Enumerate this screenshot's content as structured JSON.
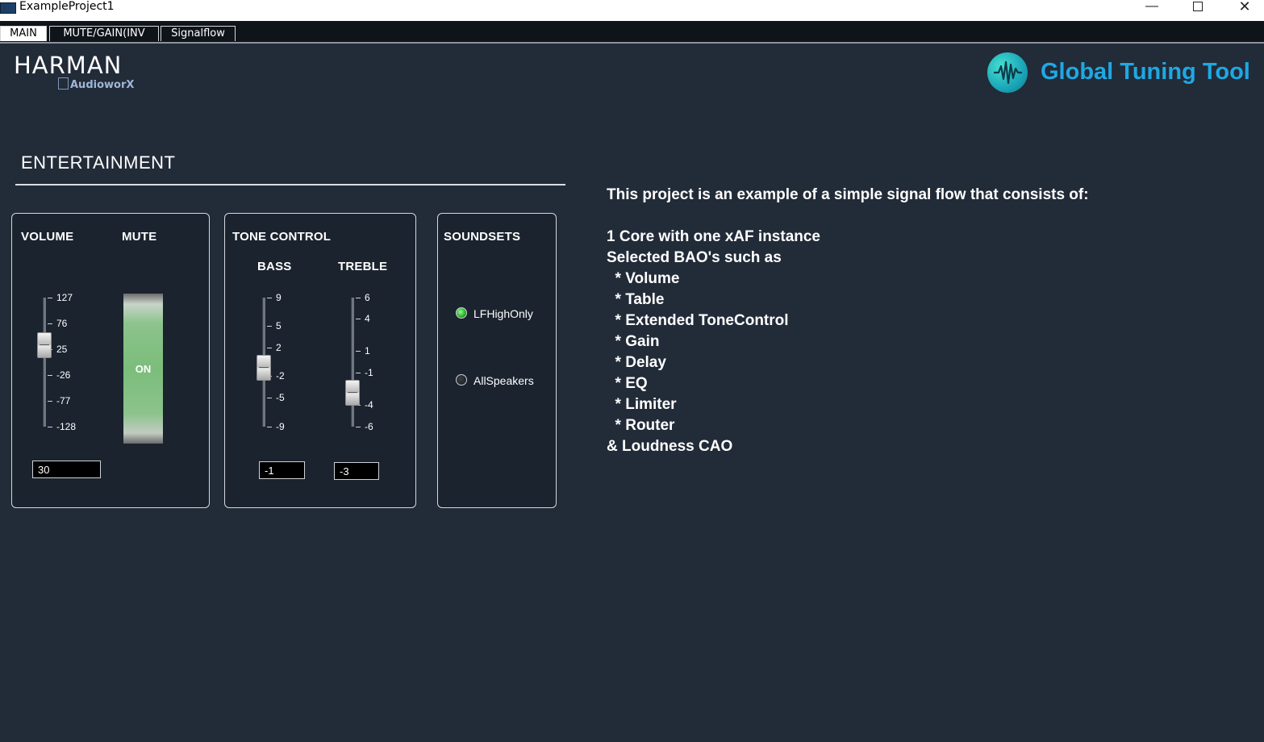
{
  "window": {
    "title": "ExampleProject1",
    "min": "—",
    "close": "✕"
  },
  "tabs": [
    {
      "label": "MAIN",
      "active": true
    },
    {
      "label": "MUTE/GAIN(INV",
      "active": false
    },
    {
      "label": "Signalflow",
      "active": false
    }
  ],
  "branding": {
    "harman": "HARMAN",
    "audioworx": "AudioworX",
    "gtt": "Global Tuning Tool",
    "gtt_icon": "waveform-logo-icon"
  },
  "section": {
    "title": "ENTERTAINMENT"
  },
  "volume": {
    "label": "VOLUME",
    "ticks": [
      "127",
      "76",
      "25",
      "-26",
      "-77",
      "-128"
    ],
    "value": "30",
    "value_number": 30,
    "range": [
      -128,
      127
    ]
  },
  "mute": {
    "label": "MUTE",
    "state": "ON"
  },
  "tone": {
    "label": "TONE CONTROL",
    "bass": {
      "label": "BASS",
      "ticks": [
        "9",
        "5",
        "2",
        "-2",
        "-5",
        "-9"
      ],
      "value": "-1",
      "value_number": -1,
      "range": [
        -9,
        9
      ]
    },
    "treble": {
      "label": "TREBLE",
      "ticks": [
        "6",
        "4",
        "1",
        "-1",
        "-4",
        "-6"
      ],
      "value": "-3",
      "value_number": -3,
      "range": [
        -6,
        6
      ]
    }
  },
  "soundsets": {
    "label": "SOUNDSETS",
    "options": [
      {
        "label": "LFHighOnly",
        "selected": true
      },
      {
        "label": "AllSpeakers",
        "selected": false
      }
    ]
  },
  "description": {
    "heading": "This project is an example of a simple signal flow that consists of:",
    "lines": [
      "1 Core with one xAF instance",
      "Selected BAO's such as",
      "  * Volume",
      "  * Table",
      "  * Extended ToneControl",
      "  * Gain",
      "  * Delay",
      "  * EQ",
      "  * Limiter",
      "  * Router",
      "& Loudness CAO"
    ]
  },
  "colors": {
    "background": "#222b38",
    "panel": "#1a232e",
    "mute_on": "#7bbd7b",
    "gtt_blue": "#1fa8e4"
  }
}
